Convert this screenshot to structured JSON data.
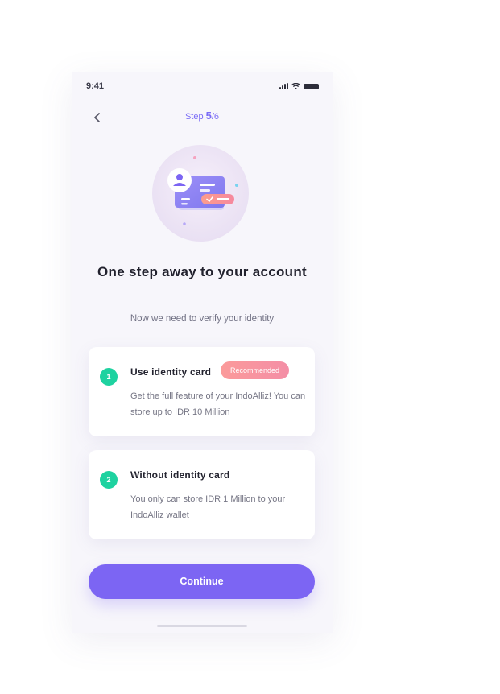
{
  "status_bar": {
    "time": "9:41",
    "icons": [
      "signal-icon",
      "wifi-icon",
      "battery-icon"
    ]
  },
  "header": {
    "back_icon": "chevron-left-icon",
    "step_label": "Step",
    "step_current": "5",
    "step_total": "/6"
  },
  "illustration": {
    "icon": "identity-card-illustration"
  },
  "main": {
    "title": "One step away to your account",
    "subtitle": "Now we need to verify your identity"
  },
  "options": [
    {
      "number": "1",
      "title": "Use identity card",
      "badge": "Recommended",
      "description": "Get the full feature of your IndoAlliz! You can store up to IDR 10 Million"
    },
    {
      "number": "2",
      "title": "Without identity card",
      "description": "You only can store IDR 1 Million to your IndoAlliz wallet"
    }
  ],
  "continue_label": "Continue",
  "colors": {
    "accent": "#7c65f3",
    "step_number": "#1ed2a0",
    "badge": "#f7949f",
    "background": "#f7f6fb"
  }
}
